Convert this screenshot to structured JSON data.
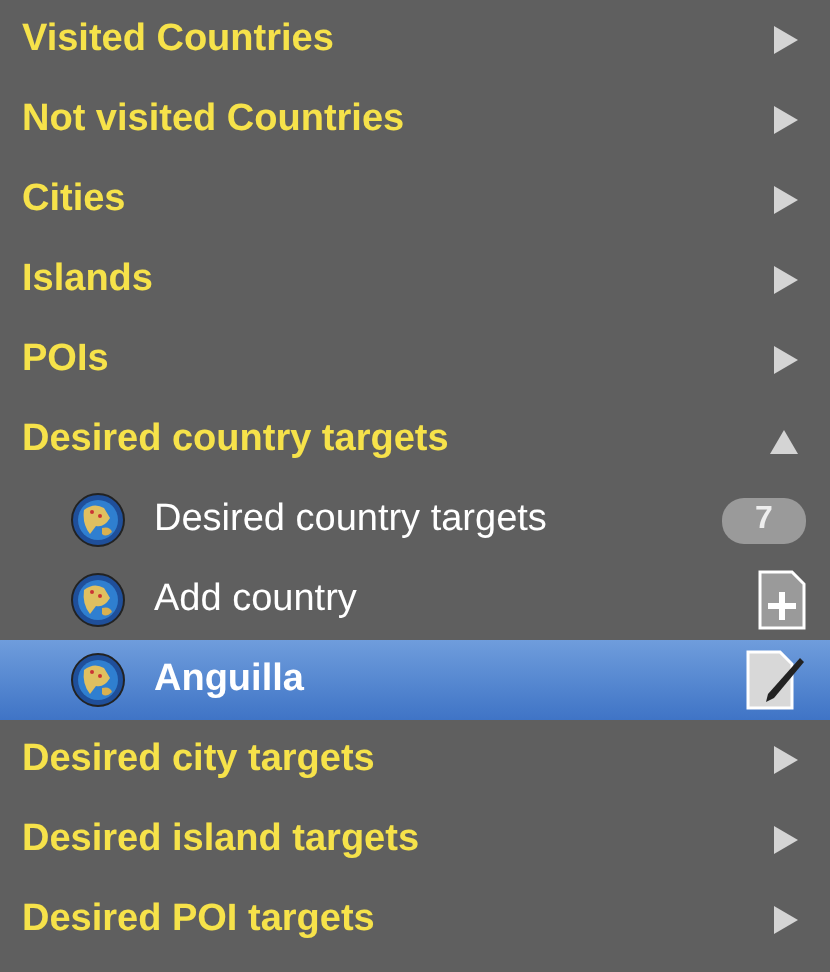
{
  "groups": [
    {
      "label": "Visited Countries",
      "expanded": false
    },
    {
      "label": "Not visited Countries",
      "expanded": false
    },
    {
      "label": "Cities",
      "expanded": false
    },
    {
      "label": "Islands",
      "expanded": false
    },
    {
      "label": "POIs",
      "expanded": false
    },
    {
      "label": "Desired country targets",
      "expanded": true,
      "children": [
        {
          "label": "Desired country targets",
          "kind": "count",
          "count": "7",
          "selected": false
        },
        {
          "label": "Add country",
          "kind": "add",
          "selected": false
        },
        {
          "label": "Anguilla",
          "kind": "edit",
          "selected": true
        }
      ]
    },
    {
      "label": "Desired city targets",
      "expanded": false
    },
    {
      "label": "Desired island targets",
      "expanded": false
    },
    {
      "label": "Desired POI targets",
      "expanded": false
    }
  ]
}
